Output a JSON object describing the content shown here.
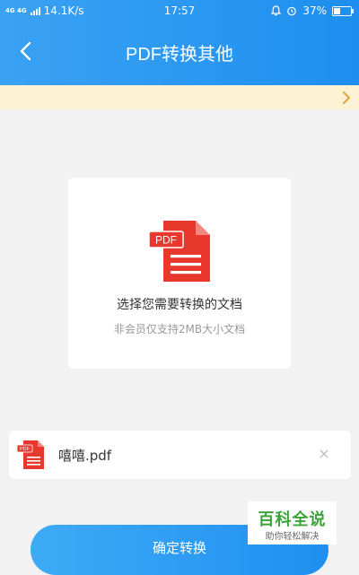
{
  "status_bar": {
    "network_label": "4G 4G",
    "speed": "14.1K/s",
    "time": "17:57",
    "battery": "37%",
    "battery_level": 0.37
  },
  "header": {
    "title": "PDF转换其他",
    "back_icon": "chevron-left-icon"
  },
  "notice_bar": {
    "chevron_icon": "chevron-right-icon",
    "background": "#fbf3d3"
  },
  "upload_card": {
    "icon_badge": "PDF",
    "title": "选择您需要转换的文档",
    "subtitle": "非会员仅支持2MB大小文档"
  },
  "selected_file": {
    "icon_badge": "PDF",
    "name": "嘻嘻.pdf",
    "remove_icon": "close-icon",
    "remove_glyph": "×"
  },
  "confirm_button": {
    "label": "确定转换"
  },
  "watermark": {
    "title": "百科全说",
    "subtitle": "助你轻松解决"
  },
  "colors": {
    "header_blue": "#1e8fef",
    "pdf_red": "#e8372c",
    "watermark_green": "#3aa43a"
  }
}
